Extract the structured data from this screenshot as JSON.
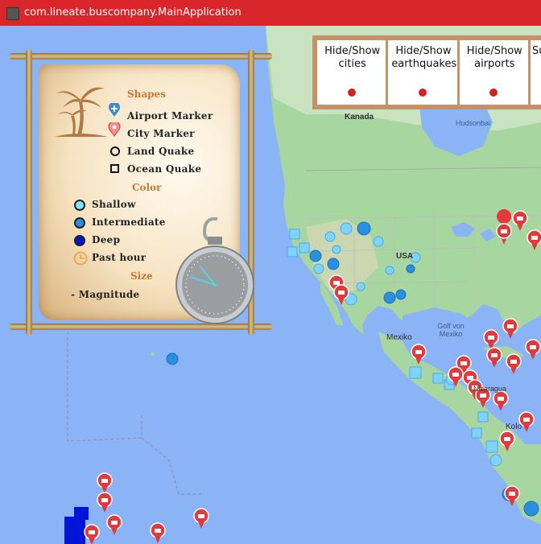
{
  "window": {
    "title": "com.lineate.buscompany.MainApplication"
  },
  "legend": {
    "shapes_heading": "Shapes",
    "airport_marker": "Airport Marker",
    "city_marker": "City Marker",
    "land_quake": "Land Quake",
    "ocean_quake": "Ocean Quake",
    "color_heading": "Color",
    "shallow": "Shallow",
    "intermediate": "Intermediate",
    "deep": "Deep",
    "past_hour": "Past hour",
    "size_heading": "Size",
    "magnitude": "- Magnitude"
  },
  "toggles": [
    {
      "label": "Hide/Show cities"
    },
    {
      "label": "Hide/Show earthquakes"
    },
    {
      "label": "Hide/Show airports"
    },
    {
      "label": "Su co"
    }
  ],
  "map_labels": {
    "kanada": "Kanada",
    "hudsonbai": "Hudsonbai",
    "usa": "USA",
    "mexiko": "Mexiko",
    "golf": "Golf von Mexiko",
    "kolumbien": "Kolo",
    "nicaragua": "Nicaragua"
  },
  "colors": {
    "titlebar": "#d9262b",
    "ocean": "#8ab4f5",
    "land": "#a7d7a0",
    "city_marker": "#e03a3a",
    "quake_shallow": "#7fd3ff",
    "quake_intermediate": "#2a8fe0",
    "quake_deep": "#0015d8"
  }
}
